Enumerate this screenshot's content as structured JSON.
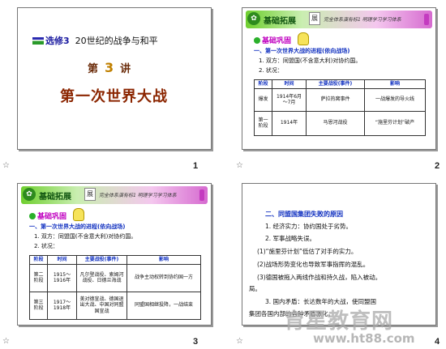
{
  "slides": [
    {
      "number": "1",
      "module_tag": "选修3",
      "module_title": "20世纪的战争与和平",
      "lecture_prefix": "第",
      "lecture_num": "3",
      "lecture_suffix": "讲",
      "title": "第一次世界大战"
    },
    {
      "number": "2",
      "banner_text": "基础拓展",
      "banner_badge": "展",
      "banner_motto": "完全体系演有标1 明理学习学习体系",
      "section": "基础巩固",
      "heading": "一、第一次世界大战的进程(依向战场)",
      "item1": "1.  双方：同盟国(不含意大利)对协约国。",
      "item2": "2.  状况：",
      "table": {
        "headers": [
          "阶段",
          "时间",
          "主要战役(事件)",
          "影响"
        ],
        "rows": [
          [
            "爆发",
            "1914年6月～7月",
            "萨拉热窝事件",
            "一战爆发的导火线"
          ],
          [
            "第一阶段",
            "1914年",
            "马恩河战役",
            "“施里芬计划”破产"
          ]
        ]
      }
    },
    {
      "number": "3",
      "banner_text": "基础拓展",
      "banner_badge": "展",
      "banner_motto": "完全体系演有标1 明理学习学习体系",
      "section": "基础巩固",
      "heading": "一、第一次世界大战的进程(依向战场)",
      "item1": "1.  双方：同盟国(不含意大利)对协约国。",
      "item2": "2.  状况：",
      "table": {
        "headers": [
          "阶段",
          "时间",
          "主要战役(事件)",
          "影响"
        ],
        "rows": [
          [
            "第二阶段",
            "1915～1916年",
            "凡尔登战役、索姆河战役、日德兰海战",
            "战争主动权转到协约国一方"
          ],
          [
            "第三阶段",
            "1917～1918年",
            "美对德宣战、德国退出大战、中国对同盟国宣战",
            "同盟国相继投降，一战结束"
          ]
        ]
      }
    },
    {
      "number": "4",
      "heading": "二、同盟国集团失败的原因",
      "lines": [
        "1.  经济实力：协约国处于劣势。",
        "2.  军事战略失误。",
        "(1)“施里芬计划”低估了对手的实力。",
        "(2)战场形势变化也导致军事指挥的混乱。",
        "(3)德国被拖入两线作战和持久战，陷入被动。",
        "局。",
        "3.  国内矛盾：长达数年的大战，使同盟国",
        "集团各国内部的各种矛盾激化。"
      ]
    }
  ],
  "watermark": {
    "text": "育星教育网",
    "url": "www.ht88.com"
  }
}
